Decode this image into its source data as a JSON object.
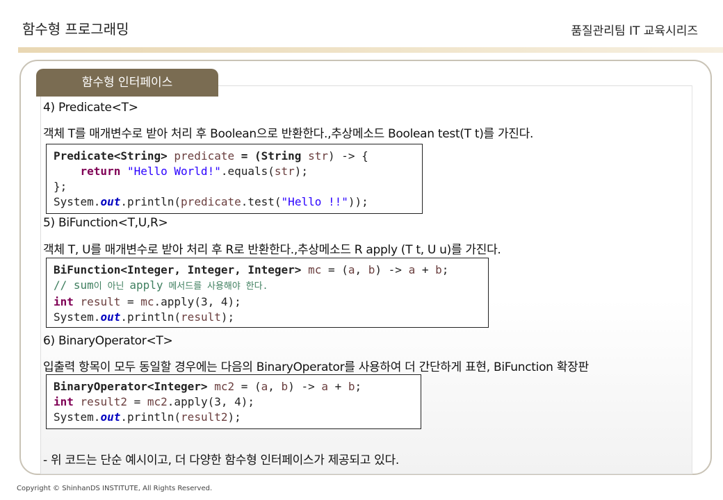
{
  "header": {
    "title": "함수형 프로그래밍",
    "series": "품질관리팀 IT 교육시리즈"
  },
  "tab": {
    "label": "함수형 인터페이스"
  },
  "sections": [
    {
      "heading": "4) Predicate<T>",
      "desc": "객체 T를 매개변수로 받아 처리 후 Boolean으로 반환한다.,추상메소드 Boolean test(T t)를 가진다.",
      "code": {
        "l1_type": "Predicate<String>",
        "l1_var": "predicate",
        "l1_rest": " = (String ",
        "l1_param": "str",
        "l1_end": ") -> {",
        "l2_kw": "return",
        "l2_str": "\"Hello World!\"",
        "l2_rest": ".equals(",
        "l2_param": "str",
        "l2_end": ");",
        "l3": "};",
        "l4_a": "System.",
        "l4_out": "out",
        "l4_b": ".println(",
        "l4_var": "predicate",
        "l4_c": ".test(",
        "l4_str": "\"Hello !!\"",
        "l4_end": "));"
      }
    },
    {
      "heading": "5) BiFunction<T,U,R>",
      "desc": "객체 T, U를 매개변수로 받아 처리 후 R로 반환한다.,추상메소드  R apply (T t, U u)를 가진다.",
      "code": {
        "l1_type": "BiFunction<Integer, Integer, Integer>",
        "l1_var": "mc",
        "l1_rest": " = (",
        "l1_a": "a",
        "l1_mid": ", ",
        "l1_b": "b",
        "l1_end": ") -> ",
        "l1_ra": "a",
        "l1_plus": " + ",
        "l1_rb": "b",
        "l1_semi": ";",
        "l2_c1": "// sum",
        "l2_k1": "이 아닌 ",
        "l2_c2": "apply",
        "l2_k2": " 메서드를 사용해야 한다.",
        "l3_kw": "int",
        "l3_var": "result",
        "l3_rest": " = ",
        "l3_mc": "mc",
        "l3_end": ".apply(3, 4);",
        "l4_a": "System.",
        "l4_out": "out",
        "l4_b": ".println(",
        "l4_var": "result",
        "l4_end": ");"
      }
    },
    {
      "heading": "6) BinaryOperator<T>",
      "desc": "입출력 항목이 모두 동일할 경우에는 다음의 BinaryOperator를 사용하여 더 간단하게 표현, BiFunction 확장판",
      "code": {
        "l1_type": "BinaryOperator<Integer>",
        "l1_var": "mc2",
        "l1_rest": " = (",
        "l1_a": "a",
        "l1_mid": ", ",
        "l1_b": "b",
        "l1_end": ") -> ",
        "l1_ra": "a",
        "l1_plus": " + ",
        "l1_rb": "b",
        "l1_semi": ";",
        "l2_kw": "int",
        "l2_var": "result2",
        "l2_rest": " = ",
        "l2_mc": "mc2",
        "l2_end": ".apply(3, 4);",
        "l3_a": "System.",
        "l3_out": "out",
        "l3_b": ".println(",
        "l3_var": "result2",
        "l3_end": ");"
      }
    }
  ],
  "note": "-   위 코드는 단순 예시이고, 더 다양한 함수형 인터페이스가 제공되고 있다.",
  "footer": "Copyright © ShinhanDS INSTITUTE, All Rights Reserved."
}
